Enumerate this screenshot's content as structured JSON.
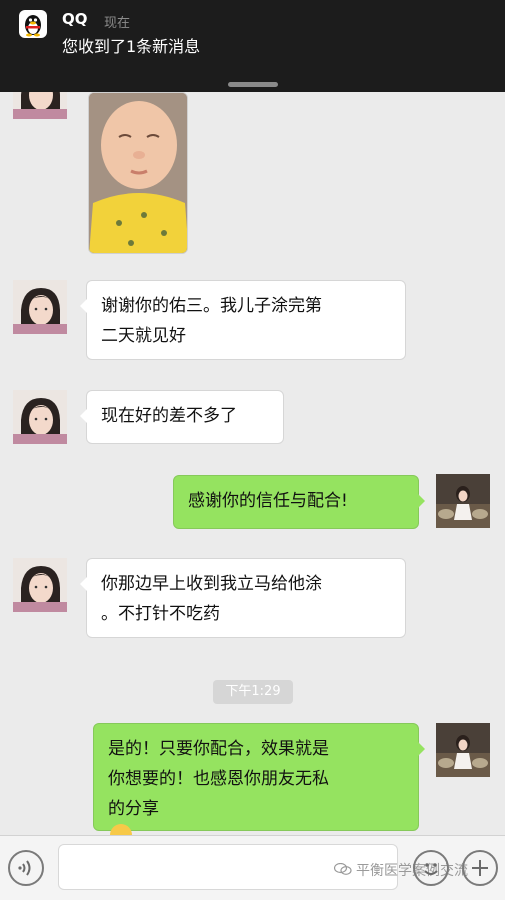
{
  "notification": {
    "app": "QQ",
    "time": "现在",
    "message": "您收到了1条新消息"
  },
  "messages": [
    {
      "from": "contact",
      "lines": [
        "谢谢你的佑三。我儿子涂完第",
        "二天就见好"
      ]
    },
    {
      "from": "contact",
      "lines": [
        "现在好的差不多了"
      ]
    },
    {
      "from": "me",
      "lines": [
        "感谢你的信任与配合!"
      ]
    },
    {
      "from": "contact",
      "lines": [
        "你那边早上收到我立马给他涂",
        "。不打针不吃药"
      ]
    },
    {
      "from": "me",
      "lines": [
        "是的！只要你配合，效果就是",
        "你想要的！也感恩你朋友无私",
        "的分享"
      ]
    }
  ],
  "timestamp": "下午1:29",
  "watermark": "平衡医学案例交流",
  "colors": {
    "outgoing_bubble": "#95e360",
    "incoming_bubble": "#ffffff",
    "background": "#ebebeb",
    "notification_bg": "#1c1c1c"
  },
  "icons": [
    "qq-penguin-icon",
    "voice-icon",
    "emoji-icon",
    "plus-icon",
    "wechat-logo-icon"
  ]
}
